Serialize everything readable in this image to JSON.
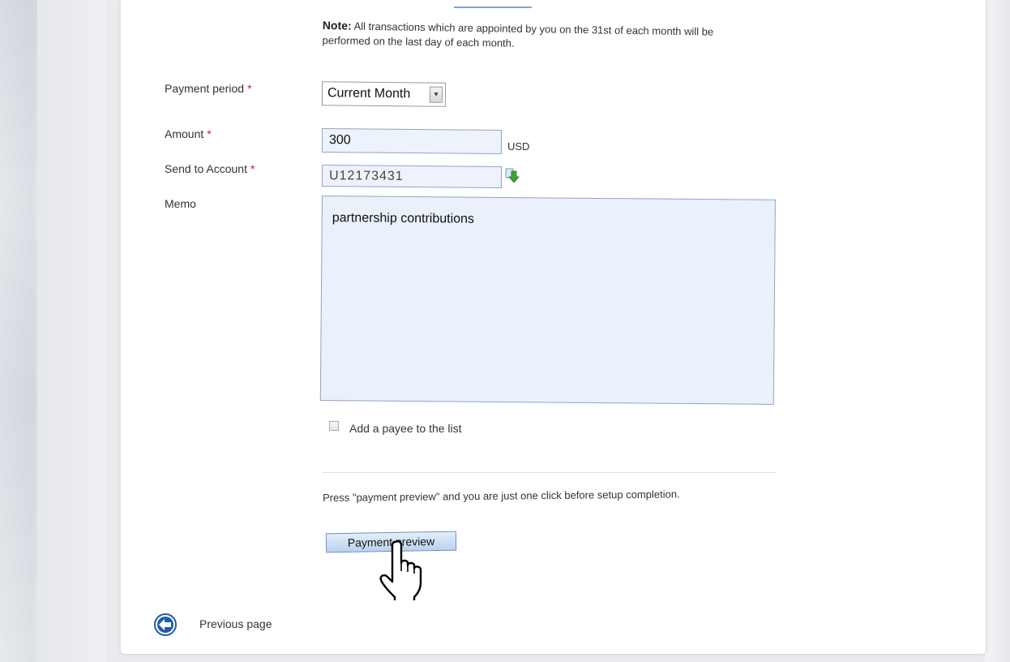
{
  "note": {
    "bold": "Note:",
    "text": "All transactions which are appointed by you on the 31st of each month will be performed on the last day of each month."
  },
  "form": {
    "required_mark": "*",
    "payment_period": {
      "label": "Payment period",
      "value": "Current Month"
    },
    "amount": {
      "label": "Amount",
      "value": "300",
      "unit": "USD"
    },
    "send_to": {
      "label": "Send to Account",
      "value": "U12173431"
    },
    "memo": {
      "label": "Memo",
      "value": "partnership contributions"
    },
    "add_payee_label": "Add a payee to the list"
  },
  "hint": "Press \"payment preview\" and you are just one click before setup completion.",
  "preview_button": "Payment preview",
  "nav": {
    "previous_label": "Previous page"
  },
  "colors": {
    "required": "#cc2222",
    "input_bg": "#eef3fb",
    "button_top": "#e4effb",
    "button_bottom": "#b9d2ee",
    "nav_icon": "#1f5ca8"
  },
  "icons": {
    "select_arrow": "chevron-down-icon",
    "account_lookup": "green-down-arrow-icon",
    "previous_page": "circle-left-arrow-icon",
    "cursor": "hand-pointer-icon"
  }
}
